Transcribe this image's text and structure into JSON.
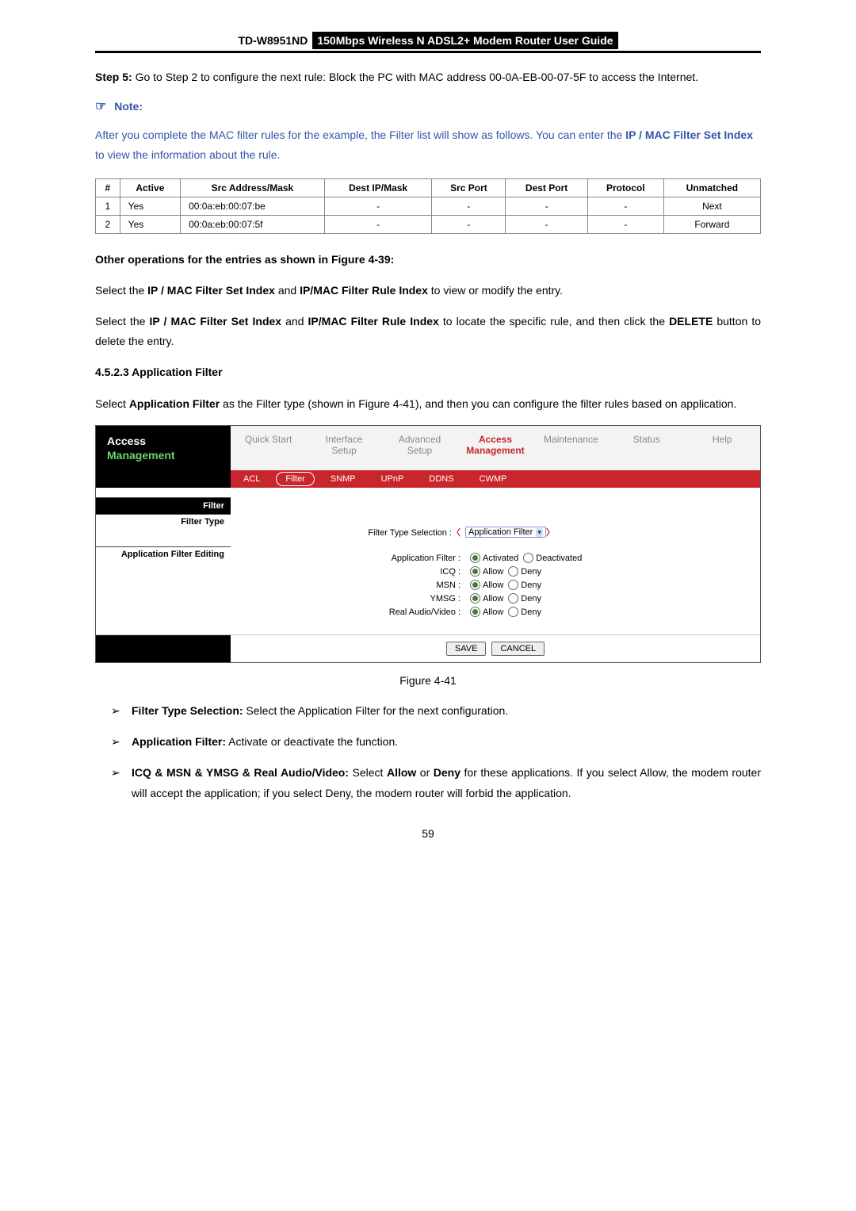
{
  "header": {
    "model": "TD-W8951ND",
    "title": "150Mbps Wireless N ADSL2+ Modem Router User Guide"
  },
  "step5": {
    "label": "Step 5:",
    "text": " Go to Step 2 to configure the next rule: Block the PC with MAC address 00-0A-EB-00-07-5F to access the Internet."
  },
  "note": {
    "icon": "☞",
    "label": "Note:",
    "body_pre": "After you complete the MAC filter rules for the example, the Filter list will show as follows. You can enter the ",
    "body_bold": "IP / MAC Filter Set Index",
    "body_post": " to view the information about the rule."
  },
  "filter_table": {
    "headers": [
      "#",
      "Active",
      "Src Address/Mask",
      "Dest IP/Mask",
      "Src Port",
      "Dest Port",
      "Protocol",
      "Unmatched"
    ],
    "rows": [
      {
        "num": "1",
        "active": "Yes",
        "src": "00:0a:eb:00:07:be",
        "dest": "-",
        "srcport": "-",
        "destport": "-",
        "proto": "-",
        "unmatched": "Next"
      },
      {
        "num": "2",
        "active": "Yes",
        "src": "00:0a:eb:00:07:5f",
        "dest": "-",
        "srcport": "-",
        "destport": "-",
        "proto": "-",
        "unmatched": "Forward"
      }
    ]
  },
  "other_ops_heading": "Other operations for the entries as shown in Figure 4-39:",
  "para1": {
    "pre": "Select the ",
    "b1": "IP / MAC Filter Set Index",
    "mid": " and ",
    "b2": "IP/MAC Filter Rule Index",
    "post": " to view or modify the entry."
  },
  "para2": {
    "pre": "Select the ",
    "b1": "IP / MAC Filter Set Index",
    "mid1": " and ",
    "b2": "IP/MAC Filter Rule Index",
    "mid2": " to locate the specific rule, and then click the ",
    "b3": "DELETE",
    "post": " button to delete the entry."
  },
  "section_heading": "4.5.2.3   Application Filter",
  "para3": {
    "pre": "Select ",
    "b1": "Application Filter",
    "post": " as the Filter type (shown in Figure 4-41), and then you can configure the filter rules based on application."
  },
  "screenshot": {
    "title_top": "Access",
    "title_bottom": "Management",
    "tabs_top": [
      "Quick Start",
      "Interface Setup",
      "Advanced Setup",
      "Access Management",
      "Maintenance",
      "Status",
      "Help"
    ],
    "active_top_idx": 3,
    "subtabs": [
      "ACL",
      "Filter",
      "SNMP",
      "UPnP",
      "DDNS",
      "CWMP"
    ],
    "active_sub_idx": 1,
    "side": {
      "filter": "Filter",
      "filter_type": "Filter Type",
      "editing": "Application Filter Editing"
    },
    "rows": {
      "filter_type_label": "Filter Type Selection :",
      "filter_type_value": "Application Filter",
      "app_filter_label": "Application Filter :",
      "activated": "Activated",
      "deactivated": "Deactivated",
      "icq_label": "ICQ :",
      "msn_label": "MSN :",
      "ymsg_label": "YMSG :",
      "rav_label": "Real Audio/Video :",
      "allow": "Allow",
      "deny": "Deny"
    },
    "buttons": {
      "save": "SAVE",
      "cancel": "CANCEL"
    }
  },
  "figure_caption": "Figure 4-41",
  "bullets": [
    {
      "b": "Filter Type Selection:",
      "t": " Select the Application Filter for the next configuration."
    },
    {
      "b": "Application Filter:",
      "t": " Activate or deactivate the function."
    },
    {
      "b": "ICQ & MSN & YMSG & Real Audio/Video:",
      "t_pre": " Select ",
      "t_b1": "Allow",
      "t_mid": " or ",
      "t_b2": "Deny",
      "t_post": " for these applications. If you select Allow, the modem router will accept the application; if you select Deny, the modem router will forbid the application."
    }
  ],
  "page_number": "59"
}
